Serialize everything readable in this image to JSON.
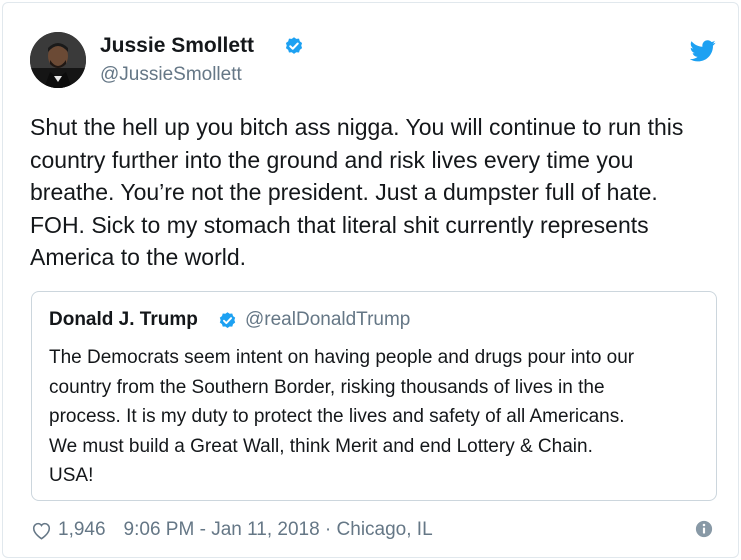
{
  "tweet": {
    "author": {
      "display_name": "Jussie Smollett",
      "handle": "@JussieSmollett",
      "verified": true
    },
    "text": "Shut the hell up you bitch ass nigga. You will continue to run this\ncountry further into the ground and risk lives every time you\nbreathe. You’re not the president. Just a dumpster full of hate.\nFOH. Sick to my stomach that literal shit currently represents\nAmerica to the world.",
    "quoted_tweet": {
      "display_name": "Donald J. Trump",
      "handle": "@realDonaldTrump",
      "verified": true,
      "text": "The Democrats seem intent on having people and drugs pour into our\ncountry from the Southern Border, risking thousands of lives in the\nprocess. It is my duty to protect the lives and safety of all Americans.\nWe must build a Great Wall, think Merit and end Lottery & Chain.\nUSA!"
    },
    "footer": {
      "likes": "1,946",
      "timestamp_location": "9:06 PM - Jan 11, 2018 · Chicago, IL"
    }
  },
  "icons": {
    "brand": "twitter-bird-icon",
    "verified": "verified-badge-icon",
    "like": "heart-icon",
    "info": "info-icon"
  },
  "colors": {
    "twitter_blue": "#1da1f2",
    "text_primary": "#14171a",
    "text_secondary": "#657786",
    "border": "#ccd6dd"
  }
}
